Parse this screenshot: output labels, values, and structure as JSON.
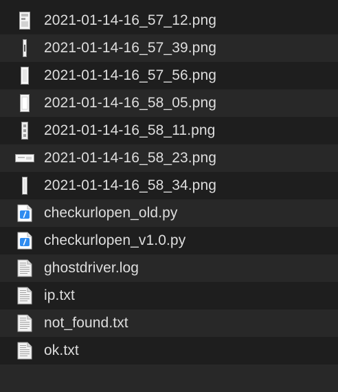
{
  "files": [
    {
      "name": "2021-01-14-16_57_12.png",
      "icon": "image-thumbnail-icon"
    },
    {
      "name": "2021-01-14-16_57_39.png",
      "icon": "image-thumbnail-icon"
    },
    {
      "name": "2021-01-14-16_57_56.png",
      "icon": "image-thumbnail-icon"
    },
    {
      "name": "2021-01-14-16_58_05.png",
      "icon": "image-thumbnail-icon"
    },
    {
      "name": "2021-01-14-16_58_11.png",
      "icon": "image-thumbnail-icon"
    },
    {
      "name": "2021-01-14-16_58_23.png",
      "icon": "image-thumbnail-icon"
    },
    {
      "name": "2021-01-14-16_58_34.png",
      "icon": "image-thumbnail-icon"
    },
    {
      "name": "checkurlopen_old.py",
      "icon": "python-file-icon"
    },
    {
      "name": "checkurlopen_v1.0.py",
      "icon": "python-file-icon"
    },
    {
      "name": "ghostdriver.log",
      "icon": "text-document-icon"
    },
    {
      "name": "ip.txt",
      "icon": "text-document-icon"
    },
    {
      "name": "not_found.txt",
      "icon": "text-document-icon"
    },
    {
      "name": "ok.txt",
      "icon": "text-document-icon"
    }
  ],
  "colors": {
    "background": "#1e1e1e",
    "stripe": "#282828",
    "text": "#dedede",
    "python_accent": "#2f8cf0"
  }
}
